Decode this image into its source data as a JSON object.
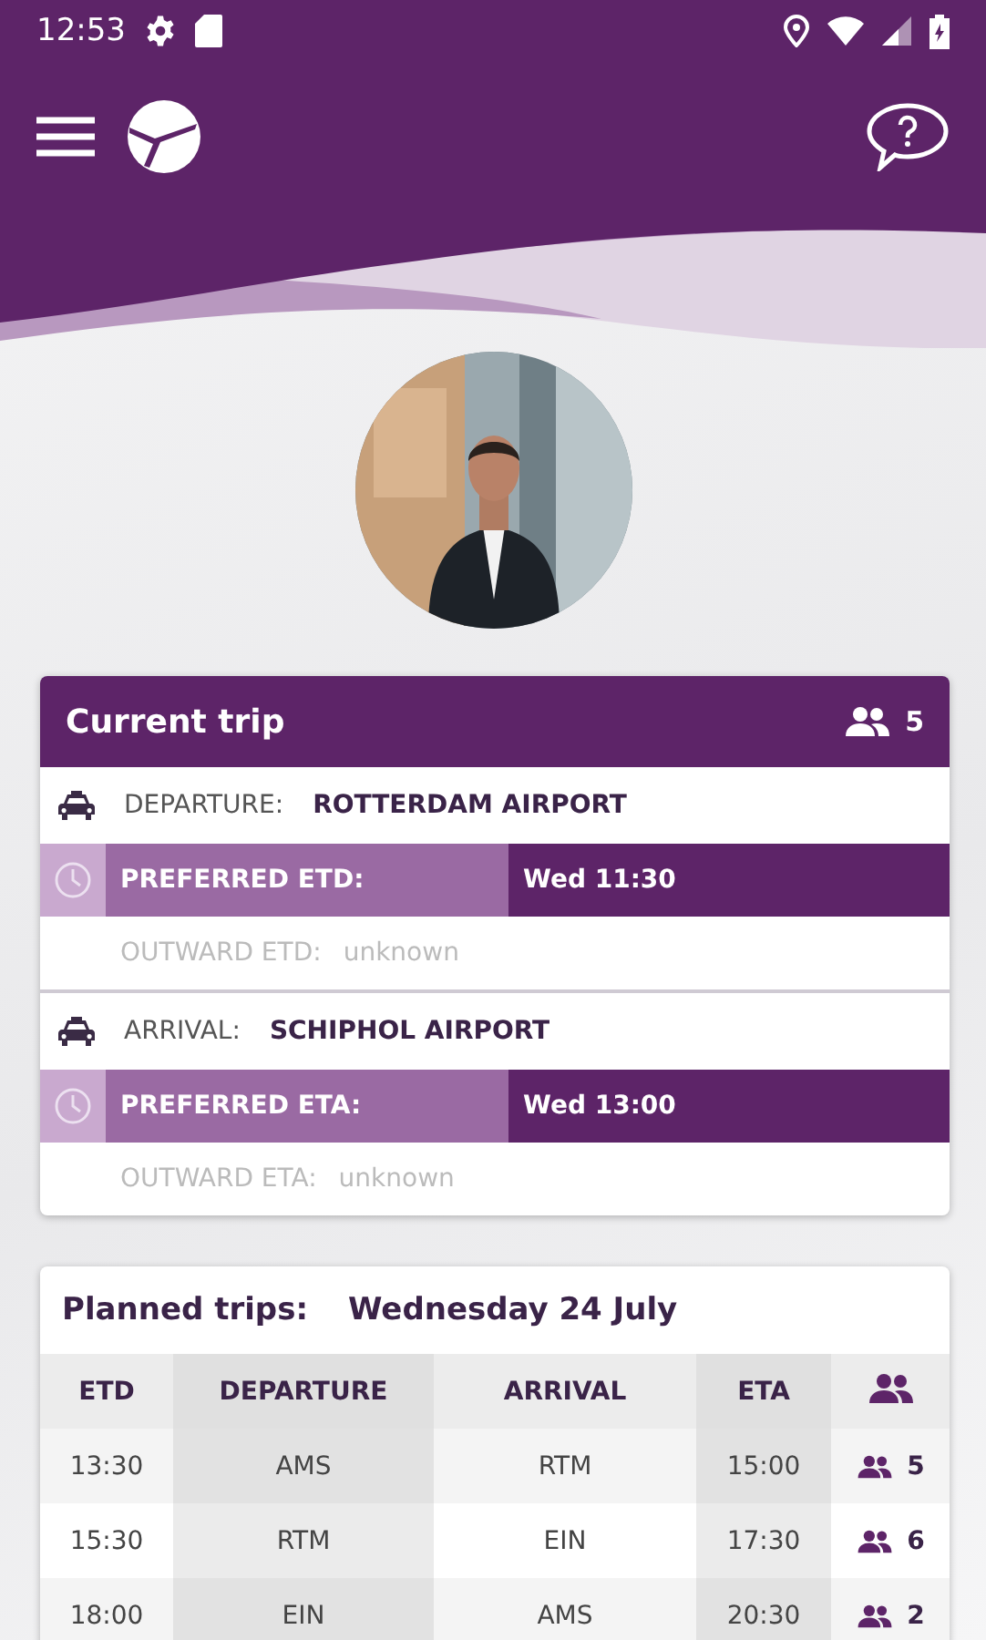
{
  "status_bar": {
    "time": "12:53"
  },
  "current_trip": {
    "title": "Current trip",
    "passengers": "5",
    "legs": [
      {
        "label": "DEPARTURE:",
        "place": "ROTTERDAM AIRPORT",
        "preferred_label": "PREFERRED ETD:",
        "preferred_value": "Wed 11:30",
        "outward_label": "OUTWARD ETD:",
        "outward_value": "unknown"
      },
      {
        "label": "ARRIVAL:",
        "place": "SCHIPHOL AIRPORT",
        "preferred_label": "PREFERRED ETA:",
        "preferred_value": "Wed 13:00",
        "outward_label": "OUTWARD ETA:",
        "outward_value": "unknown"
      }
    ]
  },
  "planned_trips": {
    "title": "Planned trips:",
    "date": "Wednesday 24 July",
    "columns": [
      "ETD",
      "DEPARTURE",
      "ARRIVAL",
      "ETA"
    ],
    "rows": [
      {
        "etd": "13:30",
        "departure": "AMS",
        "arrival": "RTM",
        "eta": "15:00",
        "passengers": "5"
      },
      {
        "etd": "15:30",
        "departure": "RTM",
        "arrival": "EIN",
        "eta": "17:30",
        "passengers": "6"
      },
      {
        "etd": "18:00",
        "departure": "EIN",
        "arrival": "AMS",
        "eta": "20:30",
        "passengers": "2"
      }
    ]
  }
}
